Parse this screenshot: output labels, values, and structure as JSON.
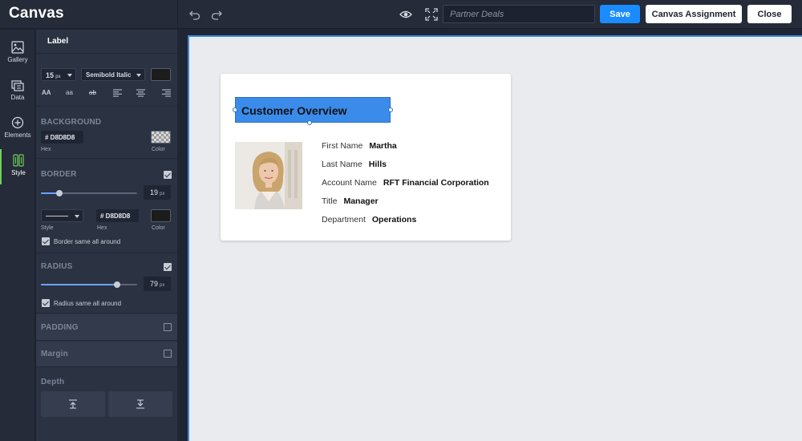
{
  "app": {
    "logo": "Canvas"
  },
  "topbar": {
    "name_placeholder": "Partner Deals",
    "save_label": "Save",
    "assign_label": "Canvas Assignment",
    "close_label": "Close"
  },
  "rail": {
    "items": [
      {
        "label": "Gallery",
        "icon": "gallery-icon"
      },
      {
        "label": "Data",
        "icon": "data-icon"
      },
      {
        "label": "Elements",
        "icon": "elements-icon"
      },
      {
        "label": "Style",
        "icon": "style-icon"
      }
    ]
  },
  "panel": {
    "title": "Label",
    "font_size": "15",
    "font_size_unit": "px",
    "font_weight": "Semibold Italic",
    "format": {
      "upper": "AA",
      "lower": "aa",
      "strike": "ab"
    },
    "background": {
      "title": "BACKGROUND",
      "hex": "# D8D8D8",
      "hex_label": "Hex",
      "color_label": "Color"
    },
    "border": {
      "title": "BORDER",
      "value": "19",
      "unit": "px",
      "level": 0.19,
      "hex": "# D8D8D8",
      "style_label": "Style",
      "hex_label": "Hex",
      "color_label": "Color",
      "same_all_around": "Border same all around"
    },
    "radius": {
      "title": "RADIUS",
      "value": "79",
      "unit": "px",
      "level": 0.79,
      "same_all_around": "Radius same all around"
    },
    "padding_title": "PADDING",
    "margin_title": "Margin",
    "depth_title": "Depth"
  },
  "card": {
    "label": "Customer Overview",
    "fields": [
      {
        "key": "First Name",
        "value": "Martha"
      },
      {
        "key": "Last Name",
        "value": "Hills"
      },
      {
        "key": "Account Name",
        "value": "RFT Financial Corporation"
      },
      {
        "key": "Title",
        "value": "Manager"
      },
      {
        "key": "Department",
        "value": "Operations"
      }
    ]
  },
  "colors": {
    "accent": "#1a8cff",
    "selection": "#3b8bea",
    "active_rail": "#6fcf5a"
  }
}
